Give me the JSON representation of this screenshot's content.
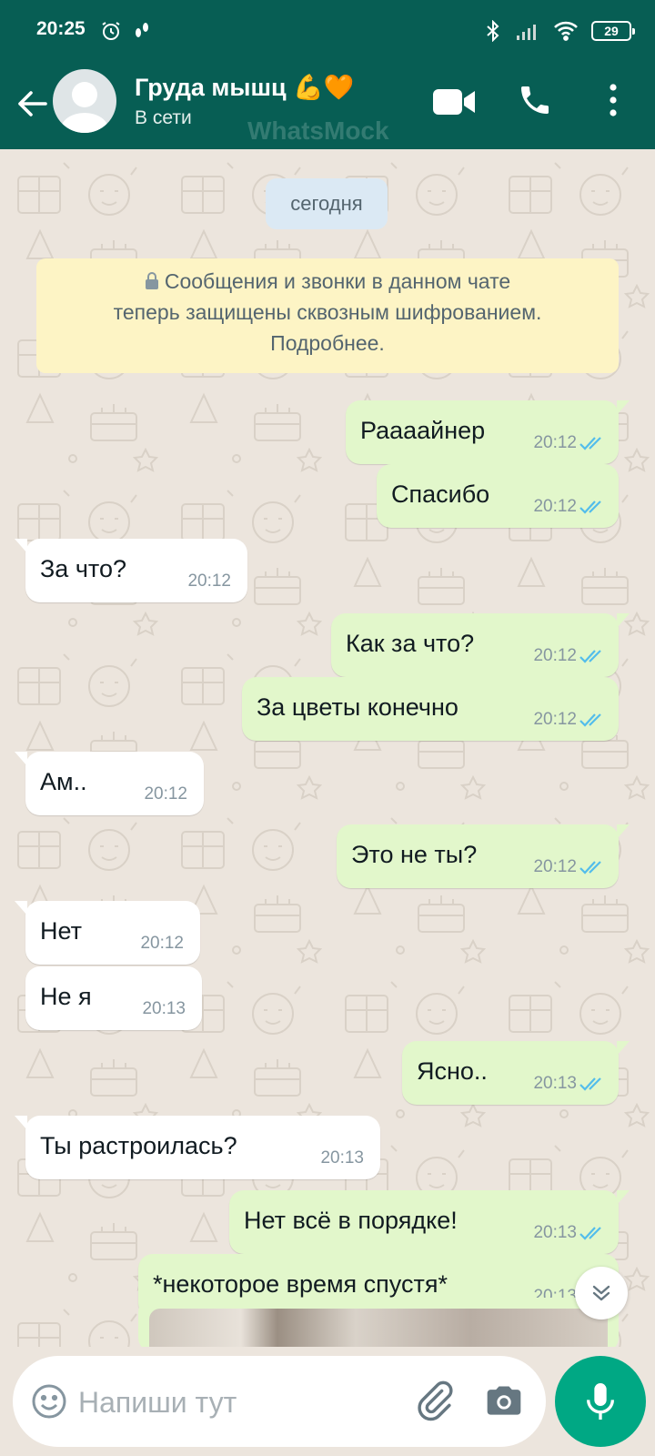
{
  "status_bar": {
    "time": "20:25",
    "battery": "29"
  },
  "header": {
    "contact_name": "Груда мышц 💪🧡",
    "contact_status": "В сети",
    "watermark": "WhatsMock"
  },
  "chat": {
    "date_chip": "сегодня",
    "encryption_notice": {
      "line1": "Сообщения и звонки в данном чате",
      "line2": "теперь защищены сквозным шифрованием.",
      "line3": "Подробнее."
    },
    "messages": [
      {
        "dir": "out",
        "text": "Раааайнер",
        "time": "20:12",
        "read": true
      },
      {
        "dir": "out",
        "text": "Спасибо",
        "time": "20:12",
        "read": true
      },
      {
        "dir": "in",
        "text": "За что?",
        "time": "20:12"
      },
      {
        "dir": "out",
        "text": "Как за что?",
        "time": "20:12",
        "read": true
      },
      {
        "dir": "out",
        "text": "За цветы конечно",
        "time": "20:12",
        "read": true
      },
      {
        "dir": "in",
        "text": "Ам..",
        "time": "20:12"
      },
      {
        "dir": "out",
        "text": "Это не ты?",
        "time": "20:12",
        "read": true
      },
      {
        "dir": "in",
        "text": "Нет",
        "time": "20:12"
      },
      {
        "dir": "in",
        "text": "Не я",
        "time": "20:13"
      },
      {
        "dir": "out",
        "text": "Ясно..",
        "time": "20:13",
        "read": true
      },
      {
        "dir": "in",
        "text": "Ты растроилась?",
        "time": "20:13"
      },
      {
        "dir": "out",
        "text": "Нет всё в порядке!",
        "time": "20:13",
        "read": true
      },
      {
        "dir": "out",
        "text": "*некоторое время спустя*",
        "time": "20:13",
        "read": true
      }
    ]
  },
  "composer": {
    "placeholder": "Напиши тут"
  },
  "colors": {
    "header": "#075e54",
    "outgoing_bubble": "#e2f7cb",
    "incoming_bubble": "#ffffff",
    "read_ticks": "#53bdeb",
    "mic_button": "#00a884",
    "chat_background": "#ece5dd"
  },
  "icons": [
    "back-arrow-icon",
    "avatar-placeholder-icon",
    "video-call-icon",
    "phone-icon",
    "more-vert-icon",
    "lock-icon",
    "double-check-icon",
    "chevrons-down-icon",
    "emoji-icon",
    "attach-icon",
    "camera-icon",
    "mic-icon"
  ]
}
